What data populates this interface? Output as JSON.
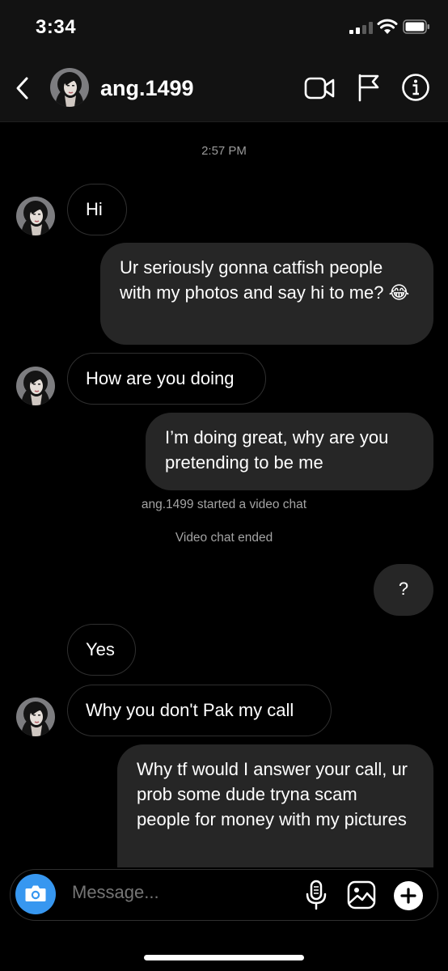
{
  "status": {
    "time": "3:34"
  },
  "header": {
    "username": "ang.1499"
  },
  "chat": {
    "timestamp": "2:57 PM",
    "messages": [
      {
        "from": "them",
        "text": "Hi"
      },
      {
        "from": "me",
        "text": "Ur seriously gonna catfish people with my photos and  say hi to me? 😂"
      },
      {
        "from": "them",
        "text": "How are you doing"
      },
      {
        "from": "me",
        "text": "I’m doing great, why are you pretending to be me"
      },
      {
        "from": "me",
        "text": "?"
      },
      {
        "from": "them",
        "text": "Yes"
      },
      {
        "from": "them",
        "text": "Why you don't Pak my call"
      },
      {
        "from": "me",
        "text": "Why tf would I answer your call, ur prob some dude tryna scam people for money with my pictures"
      }
    ],
    "system": [
      "ang.1499 started a video chat",
      "Video chat ended"
    ]
  },
  "composer": {
    "placeholder": "Message..."
  },
  "icons": {
    "back": "chevron-left-icon",
    "video": "video-camera-icon",
    "flag": "flag-icon",
    "info": "info-icon",
    "camera": "camera-icon",
    "mic": "microphone-icon",
    "gallery": "gallery-icon",
    "plus": "plus-icon"
  },
  "colors": {
    "accent": "#3797f0",
    "bubble_out": "#262626",
    "background": "#000000"
  }
}
